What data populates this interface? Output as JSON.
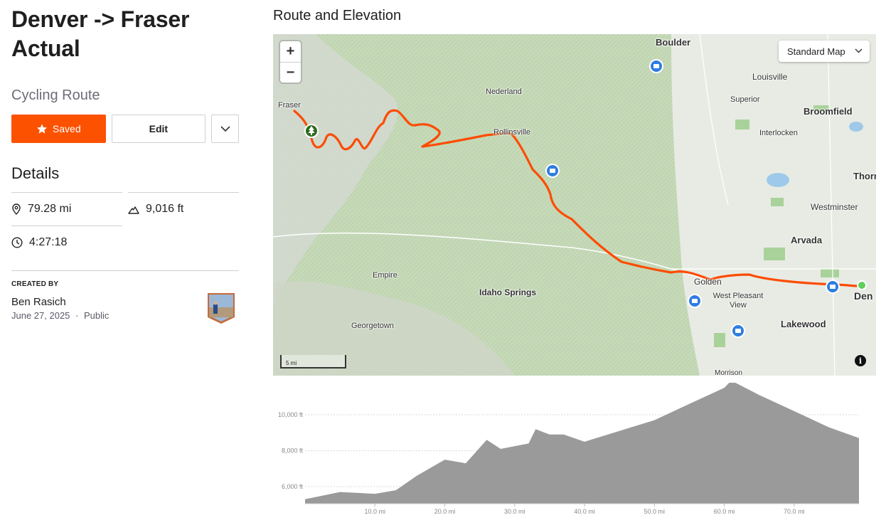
{
  "route": {
    "title": "Denver -> Fraser Actual",
    "subtitle": "Cycling Route"
  },
  "actions": {
    "saved_label": "Saved",
    "edit_label": "Edit"
  },
  "details": {
    "heading": "Details",
    "distance": "79.28 mi",
    "elevation_gain": "9,016 ft",
    "moving_time": "4:27:18"
  },
  "creator": {
    "label": "CREATED BY",
    "name": "Ben Rasich",
    "date": "June 27, 2025",
    "separator": "·",
    "visibility": "Public"
  },
  "map": {
    "section_title": "Route and Elevation",
    "style_label": "Standard Map",
    "zoom_in": "+",
    "zoom_out": "−",
    "scale_label": "5 mi",
    "info": "i",
    "places": [
      "Boulder",
      "Louisville",
      "Superior",
      "Broomfield",
      "Interlocken",
      "Nederland",
      "Rollinsville",
      "Westminster",
      "Thorn",
      "Arvada",
      "Golden",
      "West Pleasant View",
      "Lakewood",
      "Den",
      "Empire",
      "Idaho Springs",
      "Georgetown",
      "Morrison",
      "Fraser"
    ],
    "colors": {
      "route": "#fc4c02",
      "start": "#5fce5f",
      "poi": "#2f7de1",
      "terrain": "#c9dcc0"
    }
  },
  "elevation": {
    "y_ticks": [
      "6,000 ft",
      "8,000 ft",
      "10,000 ft"
    ],
    "x_ticks": [
      "10.0 mi",
      "20.0 mi",
      "30.0 mi",
      "40.0 mi",
      "50.0 mi",
      "60.0 mi",
      "70.0 mi"
    ],
    "profile_x_mi": [
      0,
      5,
      10,
      13,
      16,
      20,
      23,
      26,
      28,
      32,
      33,
      35,
      37,
      40,
      45,
      50,
      55,
      60,
      61,
      65,
      70,
      75,
      79.28
    ],
    "profile_y_ft": [
      5300,
      5700,
      5600,
      5800,
      6600,
      7500,
      7300,
      8600,
      8100,
      8400,
      9200,
      8900,
      8900,
      8500,
      9100,
      9700,
      10600,
      11500,
      11900,
      11100,
      10200,
      9300,
      8700
    ]
  }
}
